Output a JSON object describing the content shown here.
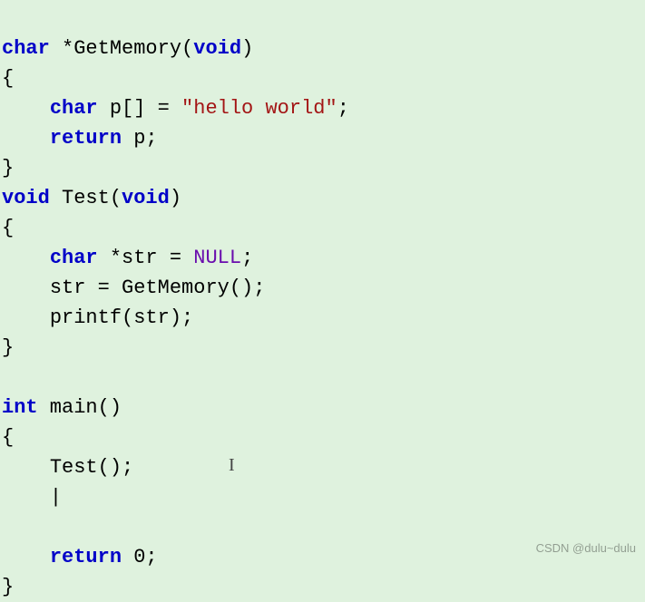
{
  "code": {
    "line1_kw1": "char",
    "line1_rest": " *GetMemory(",
    "line1_kw2": "void",
    "line1_end": ")",
    "line2": "{",
    "line3_indent": "    ",
    "line3_kw": "char",
    "line3_mid": " p[] = ",
    "line3_str": "\"hello world\"",
    "line3_end": ";",
    "line4_indent": "    ",
    "line4_kw": "return",
    "line4_rest": " p;",
    "line5": "}",
    "line6_kw1": "void",
    "line6_mid": " Test(",
    "line6_kw2": "void",
    "line6_end": ")",
    "line7": "{",
    "line8_indent": "    ",
    "line8_kw": "char",
    "line8_mid": " *str = ",
    "line8_null": "NULL",
    "line8_end": ";",
    "line9_indent": "    ",
    "line9_rest": "str = GetMemory();",
    "line10_indent": "    ",
    "line10_rest": "printf(str);",
    "line11": "}",
    "line12": "",
    "line13_kw": "int",
    "line13_rest": " main()",
    "line14": "{",
    "line15_indent": "    ",
    "line15_rest": "Test();",
    "line16_indent": "    ",
    "line16_cursor": "|",
    "line17": "",
    "line18_indent": "    ",
    "line18_kw": "return",
    "line18_rest": " 0;",
    "line19": "}"
  },
  "watermark": "CSDN @dulu~dulu",
  "caret_symbol": "I"
}
